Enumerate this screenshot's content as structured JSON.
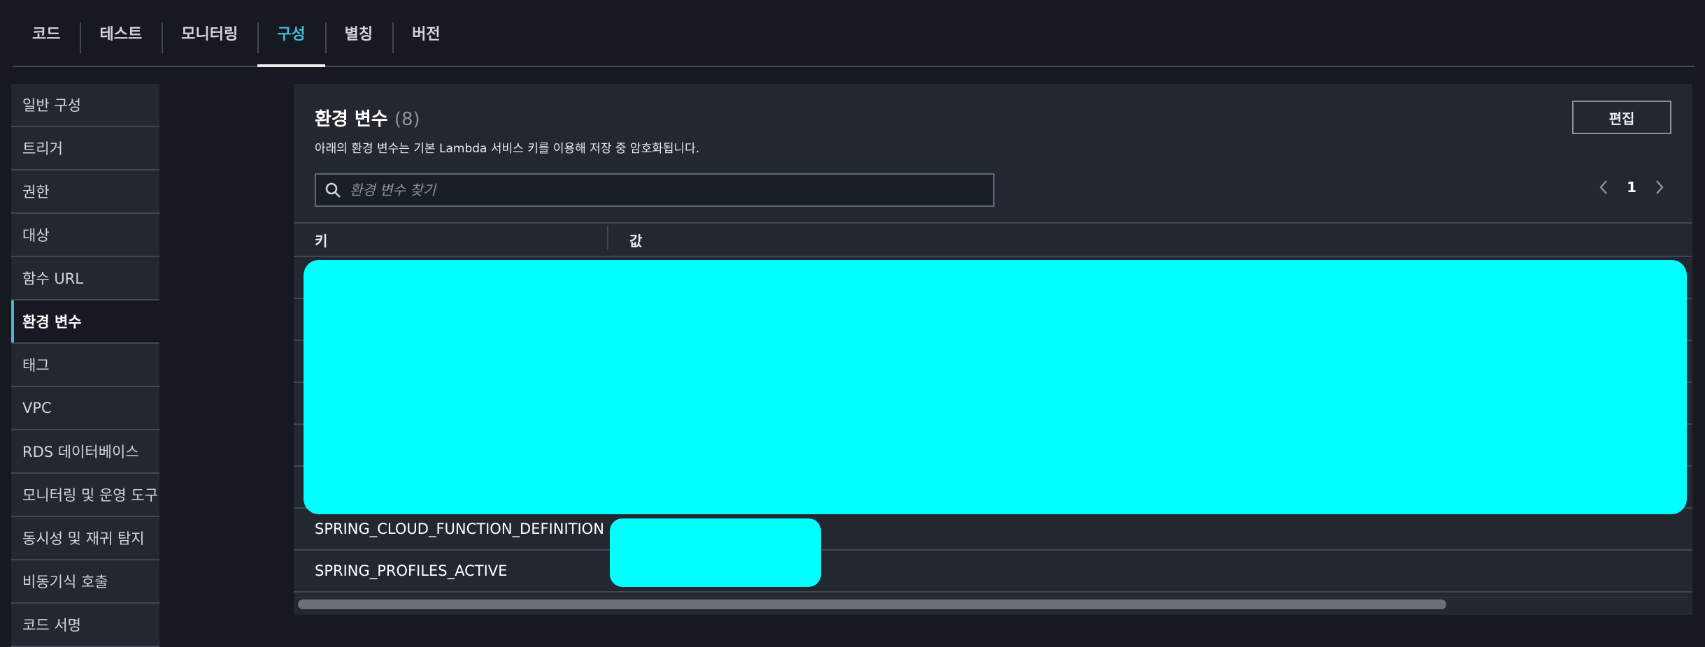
{
  "tabs": [
    {
      "label": "코드"
    },
    {
      "label": "테스트"
    },
    {
      "label": "모니터링"
    },
    {
      "label": "구성",
      "active": true
    },
    {
      "label": "별칭"
    },
    {
      "label": "버전"
    }
  ],
  "sidebar": {
    "items": [
      {
        "label": "일반 구성"
      },
      {
        "label": "트리거"
      },
      {
        "label": "권한"
      },
      {
        "label": "대상"
      },
      {
        "label": "함수 URL"
      },
      {
        "label": "환경 변수",
        "active": true
      },
      {
        "label": "태그"
      },
      {
        "label": "VPC"
      },
      {
        "label": "RDS 데이터베이스"
      },
      {
        "label": "모니터링 및 운영 도구"
      },
      {
        "label": "동시성 및 재귀 탐지"
      },
      {
        "label": "비동기식 호출"
      },
      {
        "label": "코드 서명"
      }
    ]
  },
  "panel": {
    "title": "환경 변수",
    "count": "(8)",
    "description": "아래의 환경 변수는 기본 Lambda 서비스 키를 이용해 저장 중 암호화됩니다.",
    "edit_label": "편집",
    "search_placeholder": "환경 변수 찾기",
    "page": "1"
  },
  "table": {
    "headers": {
      "key": "키",
      "value": "값"
    },
    "rows": [
      {
        "key": "",
        "value": ""
      },
      {
        "key": "",
        "value": ""
      },
      {
        "key": "",
        "value": ""
      },
      {
        "key": "",
        "value": ""
      },
      {
        "key": "",
        "value": ""
      },
      {
        "key": "",
        "value": ""
      },
      {
        "key": "SPRING_CLOUD_FUNCTION_DEFINITION",
        "value": ""
      },
      {
        "key": "SPRING_PROFILES_ACTIVE",
        "value": ""
      }
    ]
  },
  "colors": {
    "accent": "#44b9d6",
    "redaction": "#00ffff",
    "background": "#16191f",
    "panel": "#232730"
  }
}
